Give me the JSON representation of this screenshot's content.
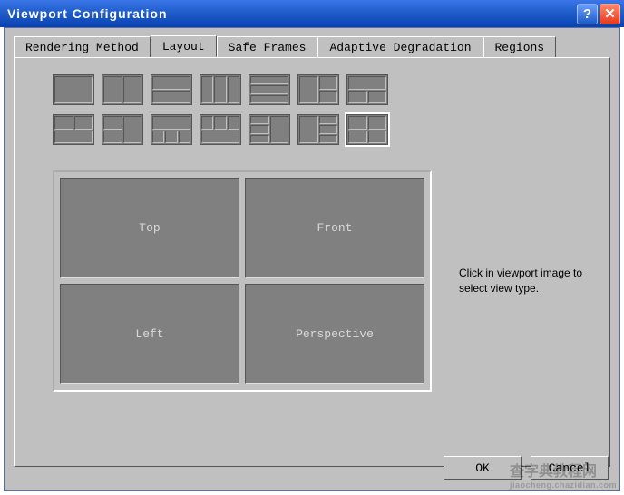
{
  "window": {
    "title": "Viewport Configuration",
    "help_glyph": "?",
    "close_glyph": "✕"
  },
  "tabs": {
    "rendering": "Rendering Method",
    "layout": "Layout",
    "safeframes": "Safe Frames",
    "adaptive": "Adaptive Degradation",
    "regions": "Regions",
    "active": "layout"
  },
  "layout_presets": {
    "row1": [
      "single",
      "v2",
      "h2",
      "v3",
      "h3",
      "l1r2",
      "t1b2"
    ],
    "row2": [
      "t2b1",
      "l2r2b",
      "t1b3",
      "t3b1",
      "l3r1",
      "l1r3",
      "quad"
    ],
    "selected": "quad"
  },
  "preview": {
    "vp0": "Top",
    "vp1": "Front",
    "vp2": "Left",
    "vp3": "Perspective"
  },
  "hint_text": "Click in viewport image to select view type.",
  "buttons": {
    "ok": "OK",
    "cancel": "Cancel"
  },
  "watermark": {
    "main": "查字典教程网",
    "sub": "jiaocheng.chazidian.com"
  }
}
